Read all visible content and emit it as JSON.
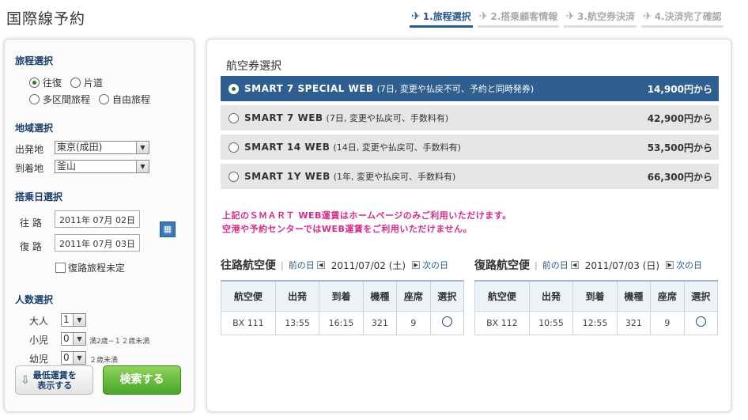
{
  "page": {
    "title": "国際線予約"
  },
  "steps": [
    {
      "label": "1.旅程選択",
      "active": true
    },
    {
      "label": "2.搭乗顧客情報",
      "active": false
    },
    {
      "label": "3.航空券決済",
      "active": false
    },
    {
      "label": "4.決済完了確認",
      "active": false
    }
  ],
  "left": {
    "trip_title": "旅程選択",
    "trip_options": [
      "往復",
      "片道",
      "多区間旅程",
      "自由旅程"
    ],
    "region_title": "地域選択",
    "departure_label": "出発地",
    "departure_value": "東京(成田)",
    "arrival_label": "到着地",
    "arrival_value": "釜山",
    "date_title": "搭乗日選択",
    "outbound_label": "往 路",
    "outbound_date": "2011年 07月 02日",
    "return_label": "復 路",
    "return_date": "2011年 07月 03日",
    "undecided_label": "復路旅程未定",
    "pax_title": "人数選択",
    "adult_label": "大人",
    "adult_value": "1",
    "child_label": "小児",
    "child_value": "0",
    "child_note": "満2歳~１２歳未満",
    "infant_label": "幼児",
    "infant_value": "0",
    "infant_note": "２歳未満",
    "lowest_fare_label_1": "最低運賃を",
    "lowest_fare_label_2": "表示する",
    "search_label": "検索する"
  },
  "fares": {
    "title": "航空券選択",
    "options": [
      {
        "name": "SMART 7 SPECIAL WEB",
        "desc": "(7日, 変更や払戻不可、予約と同時発券)",
        "price": "14,900円から",
        "selected": true
      },
      {
        "name": "SMART 7 WEB",
        "desc": "(7日, 変更や払戻可、手数料有)",
        "price": "42,900円から",
        "selected": false
      },
      {
        "name": "SMART 14 WEB",
        "desc": "(14日, 変更や払戻可、手数料有)",
        "price": "53,500円から",
        "selected": false
      },
      {
        "name": "SMART 1Y WEB",
        "desc": "(1年, 変更や払戻可、手数料有)",
        "price": "66,300円から",
        "selected": false
      }
    ],
    "notice_1": "上記のＳＭＡＲＴ WEB運賃はホームページのみご利用いただけます。",
    "notice_2": "空港や予約センターではWEB運賃をご利用いただけません。"
  },
  "flights": {
    "headers": [
      "航空便",
      "出発",
      "到着",
      "機種",
      "座席",
      "選択"
    ],
    "prev_label": "前の日",
    "next_label": "次の日",
    "outbound": {
      "title": "往路航空便",
      "date": "2011/07/02 (土)",
      "row": [
        "BX 111",
        "13:55",
        "16:15",
        "321",
        "9"
      ]
    },
    "inbound": {
      "title": "復路航空便",
      "date": "2011/07/03 (日)",
      "row": [
        "BX 112",
        "10:55",
        "12:55",
        "321",
        "9"
      ]
    }
  }
}
